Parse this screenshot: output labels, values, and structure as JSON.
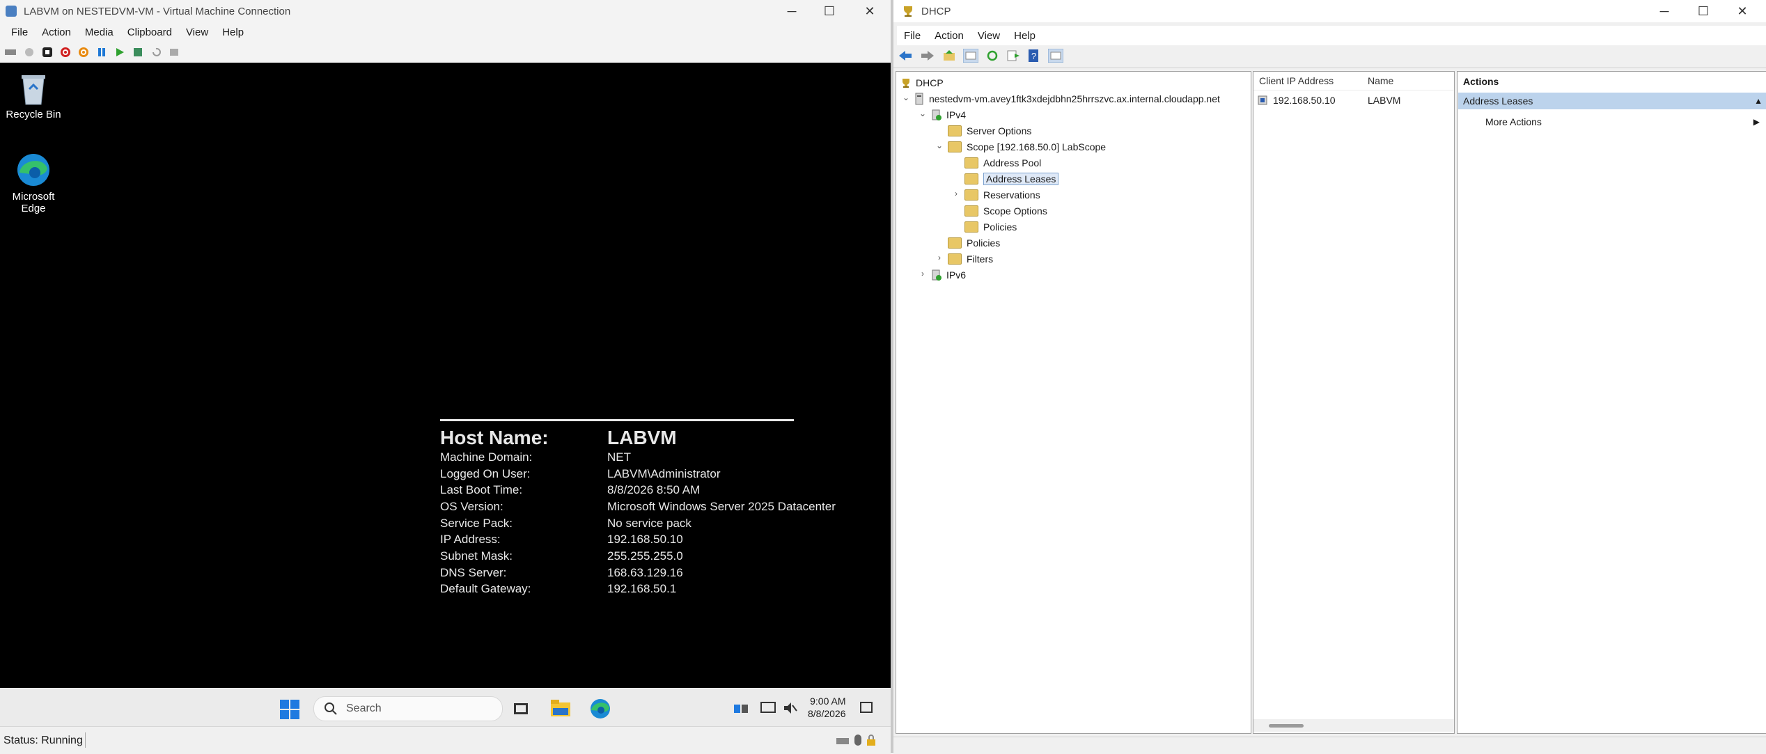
{
  "vm_window": {
    "title": "LABVM on NESTEDVM-VM - Virtual Machine Connection",
    "menu": [
      "File",
      "Action",
      "Media",
      "Clipboard",
      "View",
      "Help"
    ],
    "desktop_icons": [
      {
        "label": "Recycle Bin",
        "icon": "recycle-bin-icon"
      },
      {
        "label": "Microsoft Edge",
        "icon": "edge-icon"
      }
    ],
    "bginfo": {
      "host_label": "Host Name:",
      "host_value": "LABVM",
      "rows": [
        {
          "key": "Machine Domain:",
          "value": "NET"
        },
        {
          "key": "Logged On User:",
          "value": "LABVM\\Administrator"
        },
        {
          "key": "Last Boot Time:",
          "value": "8/8/2026 8:50 AM"
        },
        {
          "key": "OS Version:",
          "value": "Microsoft Windows Server 2025 Datacenter"
        },
        {
          "key": "Service Pack:",
          "value": "No service pack"
        },
        {
          "key": "IP Address:",
          "value": "192.168.50.10"
        },
        {
          "key": "Subnet Mask:",
          "value": "255.255.255.0"
        },
        {
          "key": "DNS Server:",
          "value": "168.63.129.16"
        },
        {
          "key": "Default Gateway:",
          "value": "192.168.50.1"
        }
      ]
    },
    "taskbar": {
      "search_placeholder": "Search",
      "time": "9:00 AM",
      "date": "8/8/2026"
    },
    "status": "Status: Running"
  },
  "dhcp_window": {
    "title": "DHCP",
    "menu": [
      "File",
      "Action",
      "View",
      "Help"
    ],
    "tree": {
      "root": "DHCP",
      "server": "nestedvm-vm.avey1ftk3xdejdbhn25hrrszvc.ax.internal.cloudapp.net",
      "ipv4": "IPv4",
      "server_options": "Server Options",
      "scope": "Scope [192.168.50.0] LabScope",
      "address_pool": "Address Pool",
      "address_leases": "Address Leases",
      "reservations": "Reservations",
      "scope_options": "Scope Options",
      "scope_policies": "Policies",
      "policies": "Policies",
      "filters": "Filters",
      "ipv6": "IPv6"
    },
    "leases": {
      "columns": [
        "Client IP Address",
        "Name"
      ],
      "rows": [
        {
          "ip": "192.168.50.10",
          "name": "LABVM"
        }
      ]
    },
    "actions": {
      "header": "Actions",
      "section": "Address Leases",
      "more": "More Actions"
    }
  },
  "colors": {
    "vm_desktop": "#000000",
    "selection": "#dfe9f7",
    "actions_section": "#bcd3ec"
  }
}
